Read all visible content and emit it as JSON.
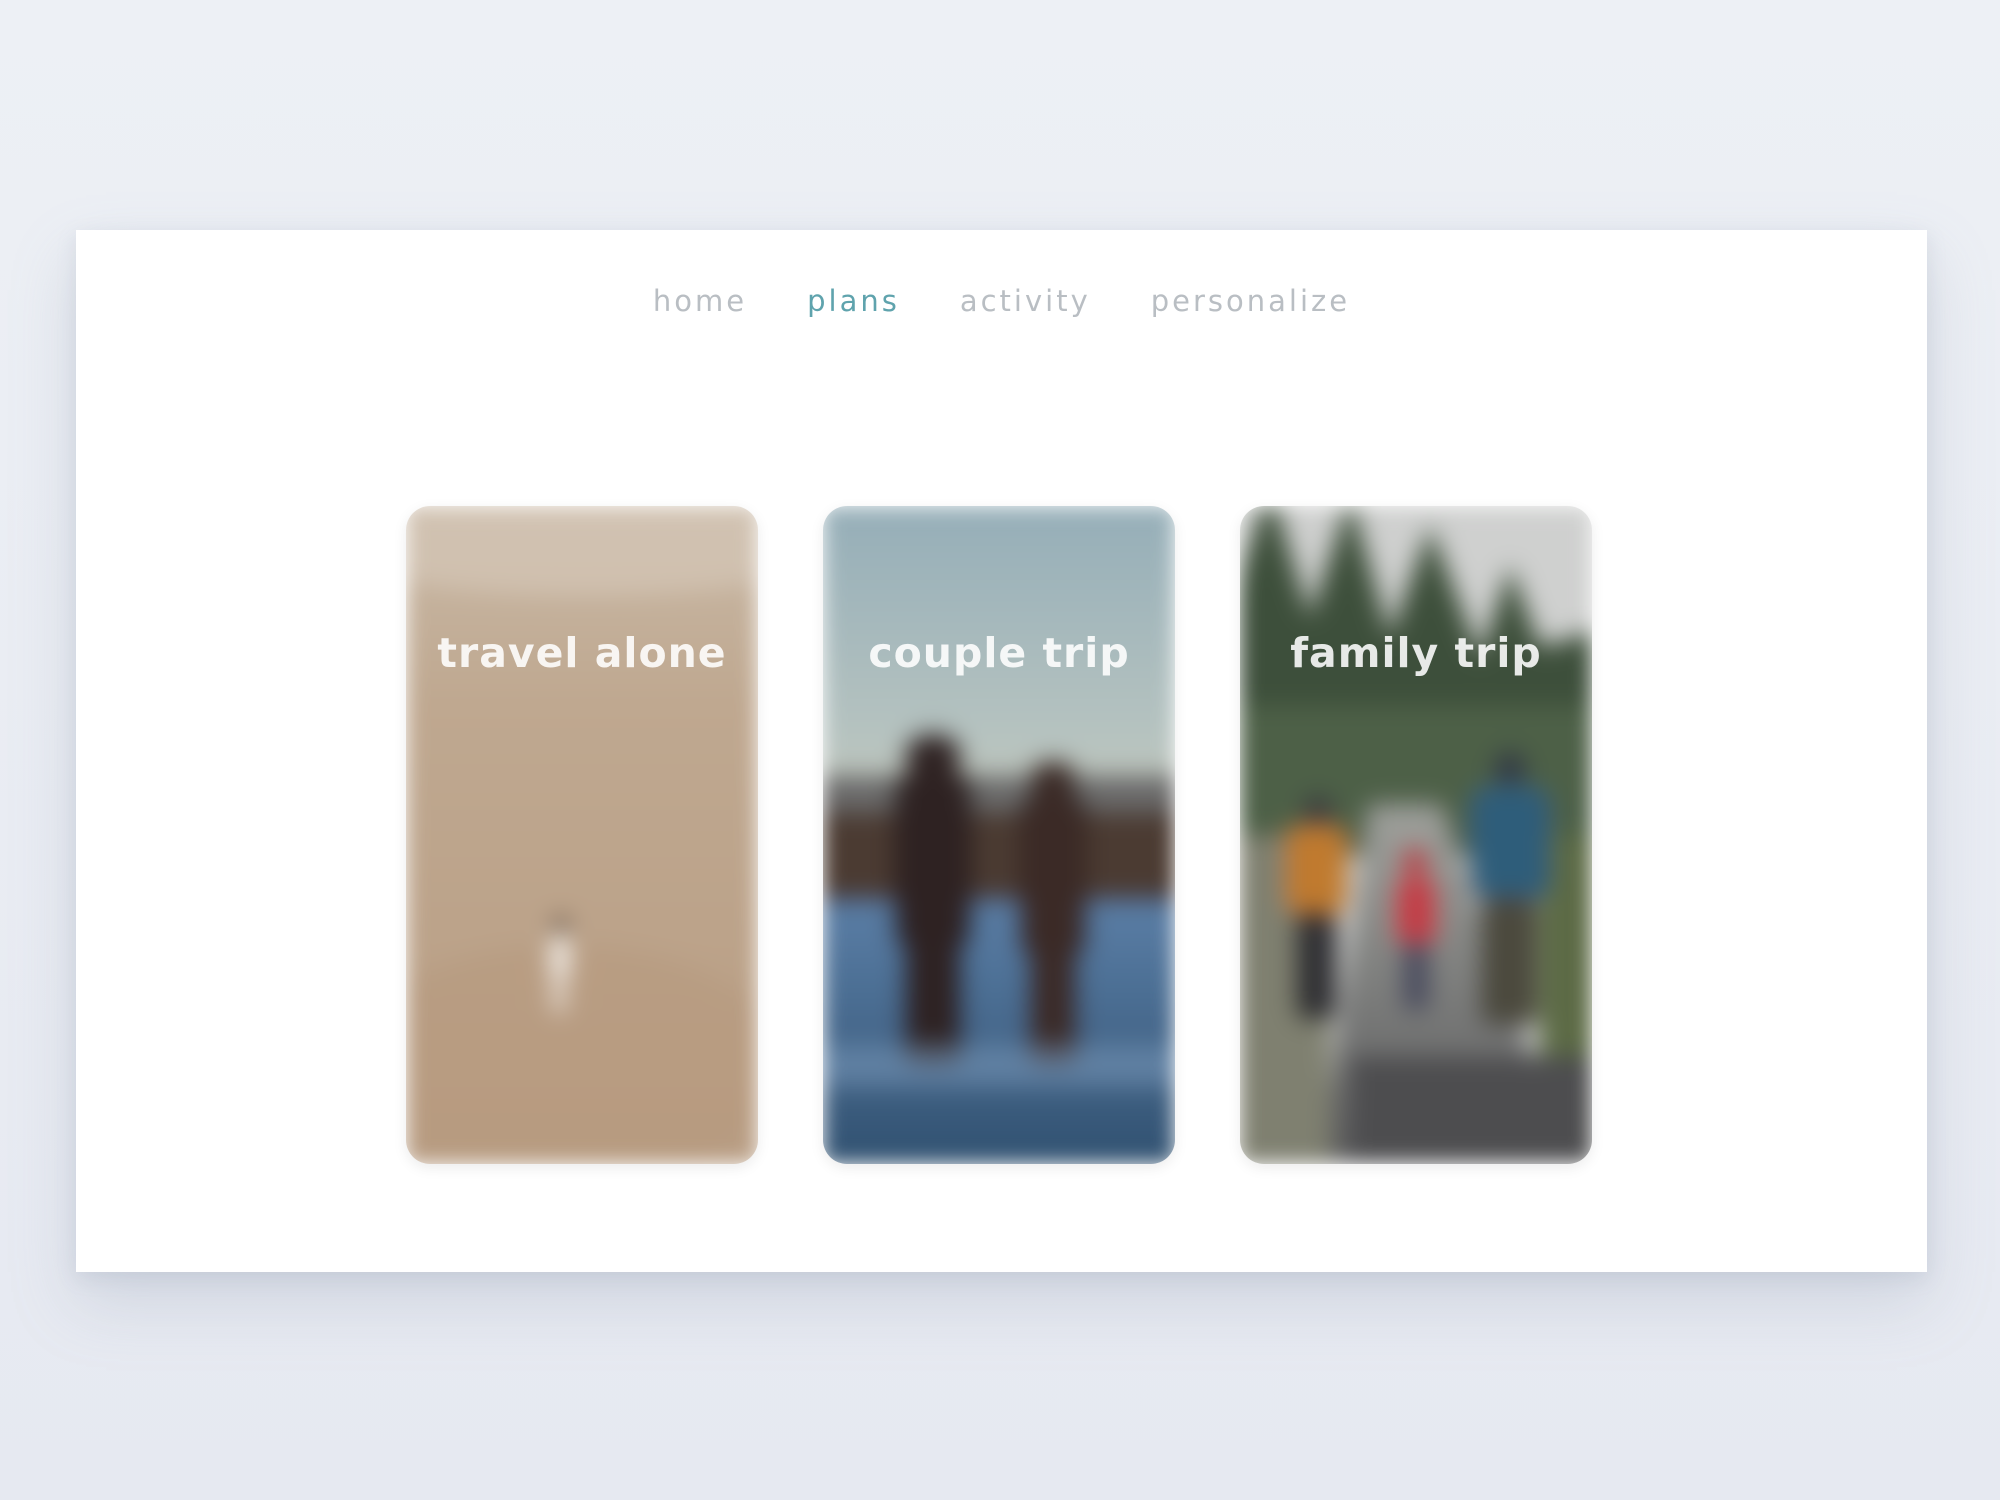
{
  "nav": {
    "items": [
      {
        "label": "home",
        "active": false
      },
      {
        "label": "plans",
        "active": true
      },
      {
        "label": "activity",
        "active": false
      },
      {
        "label": "personalize",
        "active": false
      }
    ],
    "active_color": "#5fa3ad",
    "inactive_color": "#b9bec3"
  },
  "cards": [
    {
      "title": "travel alone",
      "image": "child-walking-on-sand"
    },
    {
      "title": "couple trip",
      "image": "couple-holding-hands-at-lake"
    },
    {
      "title": "family trip",
      "image": "family-walking-on-forest-road"
    }
  ]
}
